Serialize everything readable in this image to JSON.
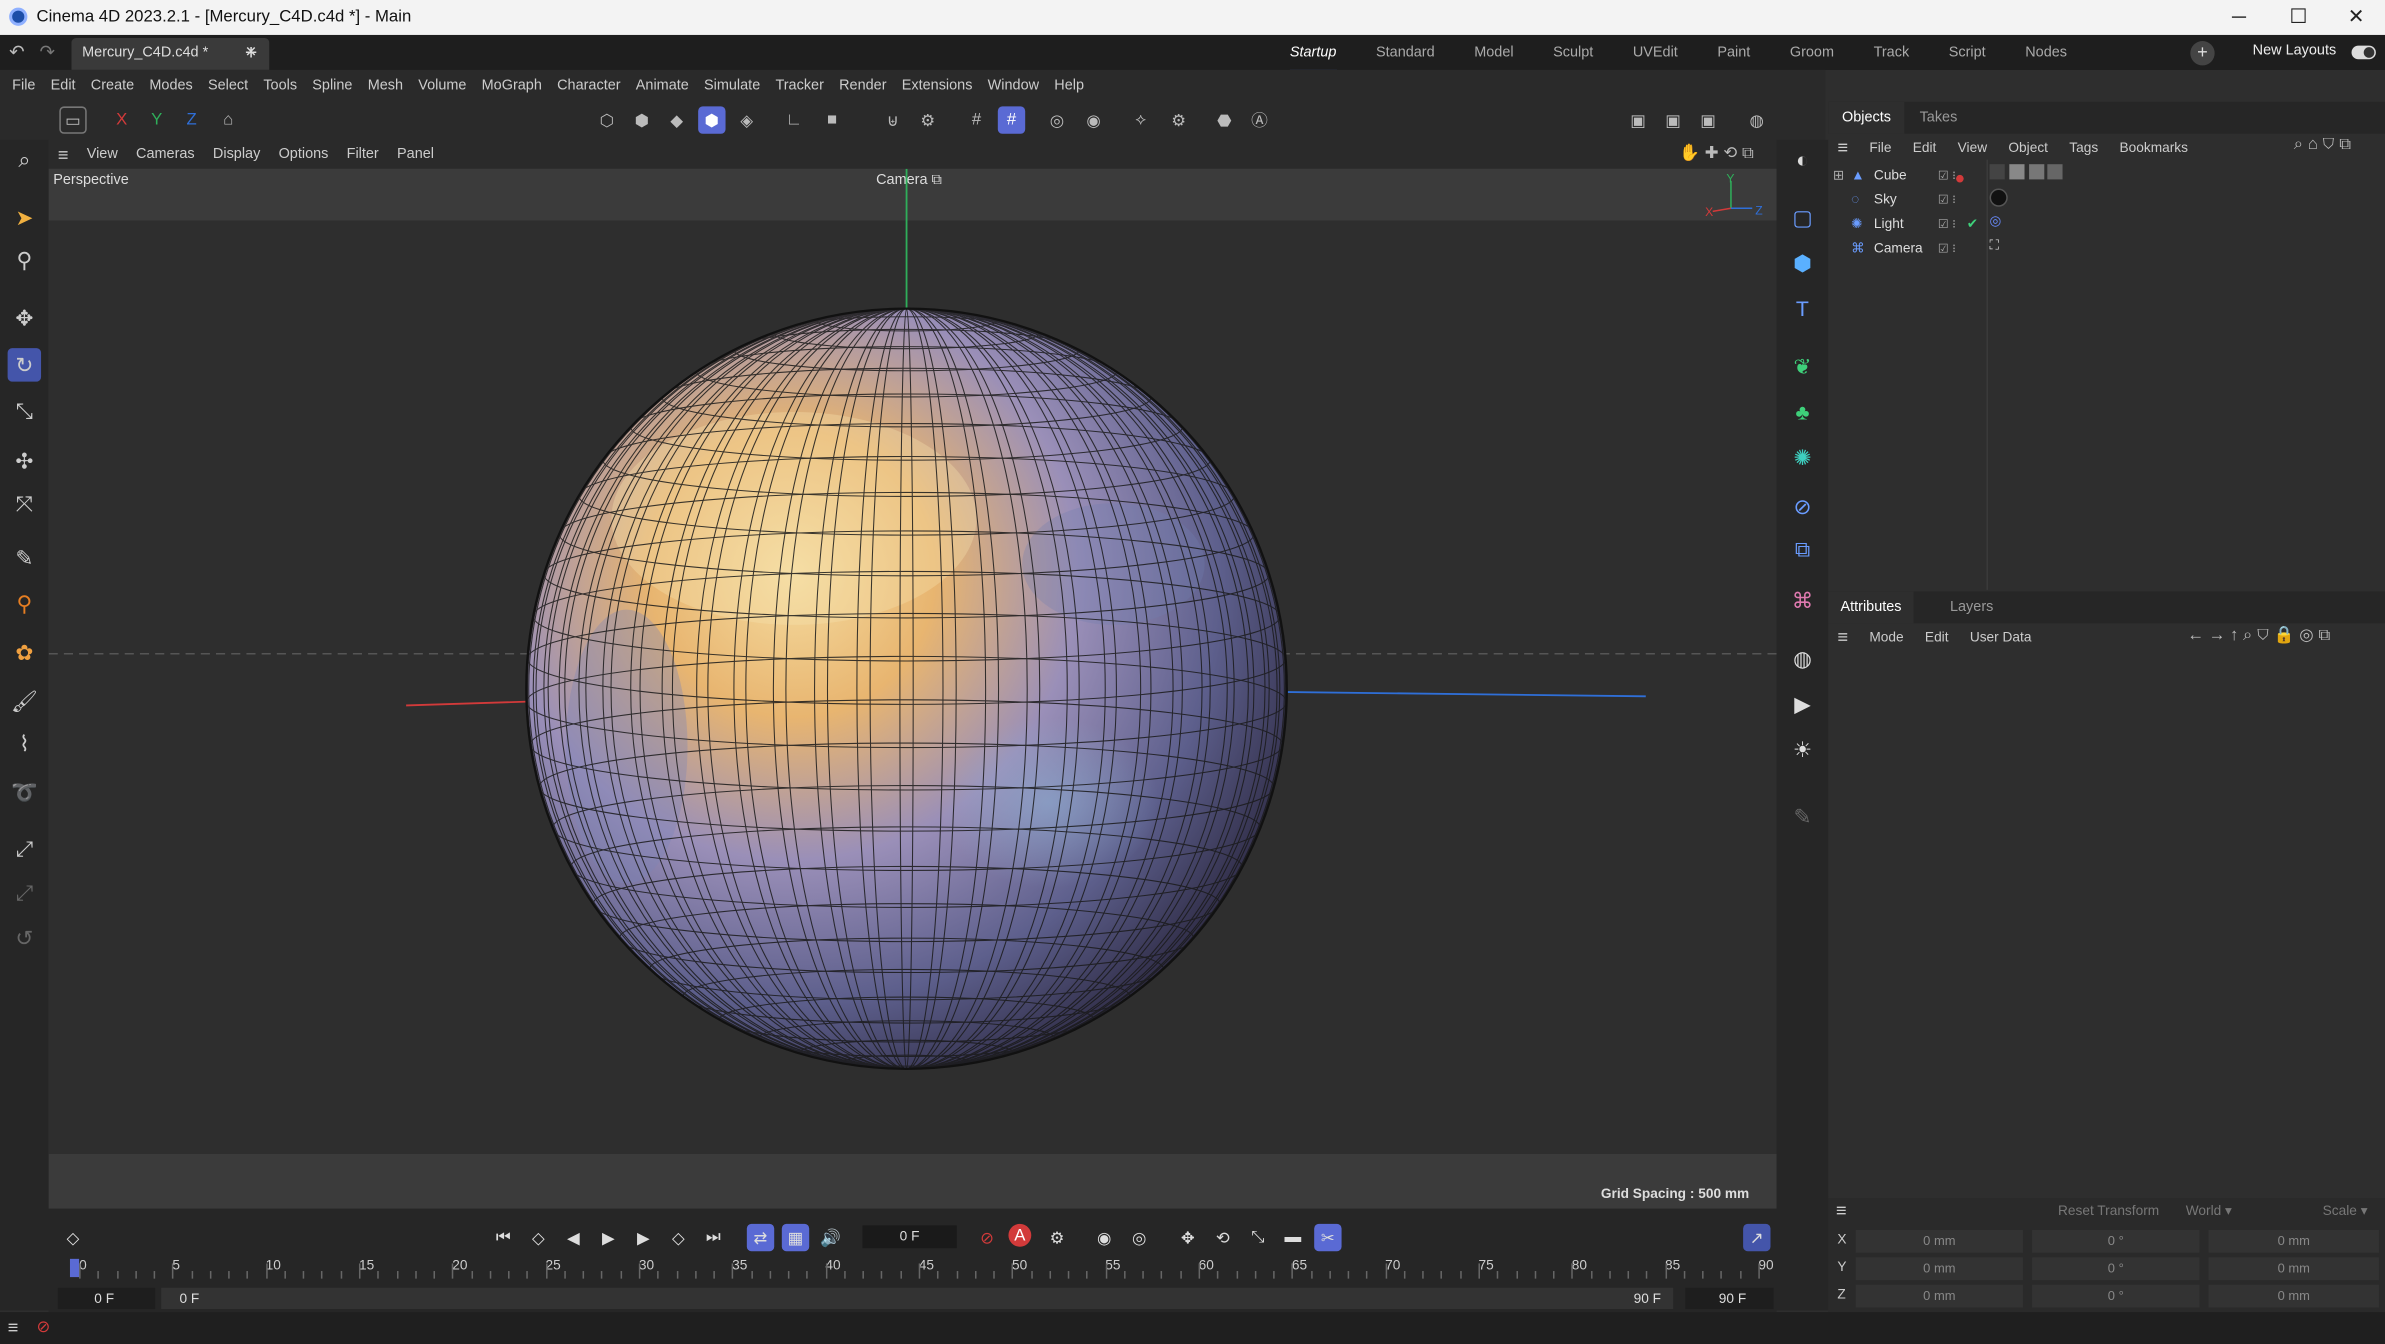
{
  "window": {
    "title": "Cinema 4D 2023.2.1 - [Mercury_C4D.c4d *] - Main"
  },
  "tabs": {
    "document": "Mercury_C4D.c4d *",
    "add": "+"
  },
  "layouts": {
    "items": [
      "Startup",
      "Standard",
      "Model",
      "Sculpt",
      "UVEdit",
      "Paint",
      "Groom",
      "Track",
      "Script",
      "Nodes"
    ],
    "active": "Startup",
    "new_layouts": "New Layouts"
  },
  "menu": [
    "File",
    "Edit",
    "Create",
    "Modes",
    "Select",
    "Tools",
    "Spline",
    "Mesh",
    "Volume",
    "MoGraph",
    "Character",
    "Animate",
    "Simulate",
    "Tracker",
    "Render",
    "Extensions",
    "Window",
    "Help"
  ],
  "axes": {
    "x": "X",
    "y": "Y",
    "z": "Z"
  },
  "viewport": {
    "menu": [
      "View",
      "Cameras",
      "Display",
      "Options",
      "Filter",
      "Panel"
    ],
    "name": "Perspective",
    "camera": "Camera",
    "grid_spacing": "Grid Spacing : 500 mm"
  },
  "objects": {
    "tabs": [
      "Objects",
      "Takes"
    ],
    "menu": [
      "File",
      "Edit",
      "View",
      "Object",
      "Tags",
      "Bookmarks"
    ],
    "items": [
      {
        "name": "Cube",
        "icon": "cube-icon"
      },
      {
        "name": "Sky",
        "icon": "sky-icon"
      },
      {
        "name": "Light",
        "icon": "light-icon"
      },
      {
        "name": "Camera",
        "icon": "camera-icon"
      }
    ]
  },
  "attributes": {
    "tabs": [
      "Attributes",
      "Layers"
    ],
    "menu": [
      "Mode",
      "Edit",
      "User Data"
    ]
  },
  "coords": {
    "reset": "Reset Transform",
    "space": "World",
    "mode": "Scale",
    "rows": [
      {
        "axis": "X",
        "pos": "0 mm",
        "rot": "0 °",
        "scale": "0 mm"
      },
      {
        "axis": "Y",
        "pos": "0 mm",
        "rot": "0 °",
        "scale": "0 mm"
      },
      {
        "axis": "Z",
        "pos": "0 mm",
        "rot": "0 °",
        "scale": "0 mm"
      }
    ]
  },
  "timeline": {
    "current_frame": "0 F",
    "start": "0 F",
    "start2": "0 F",
    "end": "90 F",
    "end2": "90 F",
    "ticks": [
      "0",
      "5",
      "10",
      "15",
      "20",
      "25",
      "30",
      "35",
      "40",
      "45",
      "50",
      "55",
      "60",
      "65",
      "70",
      "75",
      "80",
      "85",
      "90"
    ]
  },
  "colors": {
    "accent": "#5a6ad4",
    "axis_x": "#d23a3a",
    "axis_y": "#2fae5a",
    "axis_z": "#2f6fd8"
  }
}
